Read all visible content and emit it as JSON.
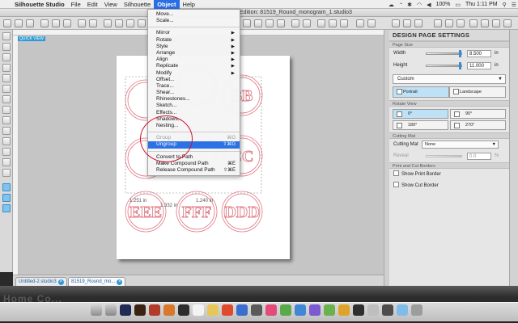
{
  "menubar": {
    "app_name": "Silhouette Studio",
    "items": [
      "File",
      "Edit",
      "View",
      "Silhouette",
      "Object",
      "Help"
    ],
    "active": "Object",
    "time": "Thu 1:11 PM",
    "battery": "100%"
  },
  "window": {
    "doc_title": "Edition: 81519_Round_monogram_1.studio3"
  },
  "quick_view_label": "QUICK VIEW",
  "object_menu": {
    "items": [
      {
        "label": "Move...",
        "type": "item"
      },
      {
        "label": "Scale...",
        "type": "item"
      },
      {
        "type": "sep"
      },
      {
        "label": "Mirror",
        "type": "submenu"
      },
      {
        "label": "Rotate",
        "type": "submenu"
      },
      {
        "label": "Style",
        "type": "submenu"
      },
      {
        "label": "Arrange",
        "type": "submenu"
      },
      {
        "label": "Align",
        "type": "submenu"
      },
      {
        "label": "Replicate",
        "type": "submenu"
      },
      {
        "label": "Modify",
        "type": "submenu"
      },
      {
        "label": "Offset...",
        "type": "item"
      },
      {
        "label": "Trace...",
        "type": "item"
      },
      {
        "label": "Shear...",
        "type": "item"
      },
      {
        "label": "Rhinestones...",
        "type": "item"
      },
      {
        "label": "Sketch...",
        "type": "item"
      },
      {
        "label": "Effects...",
        "type": "item"
      },
      {
        "label": "Shadows...",
        "type": "item"
      },
      {
        "label": "Nesting...",
        "type": "item"
      },
      {
        "type": "sep"
      },
      {
        "label": "Group",
        "shortcut": "⌘G",
        "type": "disabled"
      },
      {
        "label": "Ungroup",
        "shortcut": "⇧⌘G",
        "type": "highlight"
      },
      {
        "type": "sep"
      },
      {
        "label": "Convert to Path",
        "type": "item"
      },
      {
        "label": "Make Compound Path",
        "shortcut": "⌘E",
        "type": "item"
      },
      {
        "label": "Release Compound Path",
        "shortcut": "⇧⌘E",
        "type": "item"
      }
    ]
  },
  "canvas": {
    "monograms_row1": [
      "BB"
    ],
    "monograms_row2": [
      "CC"
    ],
    "monograms_row3": [
      "EEE",
      "FFF",
      "DDD"
    ],
    "dim_label_1": "1.251 in",
    "dim_label_2": "1.332 in",
    "dim_label_3": "1.240 in",
    "guide_color": "#e07a85"
  },
  "tabs": [
    {
      "label": "Untitled-2.studio3",
      "active": false
    },
    {
      "label": "81519_Round_mo...",
      "active": true
    }
  ],
  "panel": {
    "title": "DESIGN PAGE SETTINGS",
    "page_size_label": "Page Size",
    "width_label": "Width",
    "width_value": "8.500",
    "height_label": "Height",
    "height_value": "11.000",
    "unit": "in",
    "size_preset": "Custom",
    "portrait_label": "Portrait",
    "landscape_label": "Landscape",
    "rotate_view_label": "Rotate View",
    "rotate_options": [
      "0°",
      "90°",
      "180°",
      "270°"
    ],
    "cutting_mat_section": "Cutting Mat",
    "cutting_mat_label": "Cutting Mat",
    "cutting_mat_value": "None",
    "reveal_label": "Reveal",
    "reveal_value": "0.0",
    "reveal_unit": "%",
    "print_cut_borders_label": "Print and Cut Borders",
    "show_print_border": "Show Print Border",
    "show_cut_border": "Show Cut Border"
  },
  "dock_text": "Home Co..."
}
